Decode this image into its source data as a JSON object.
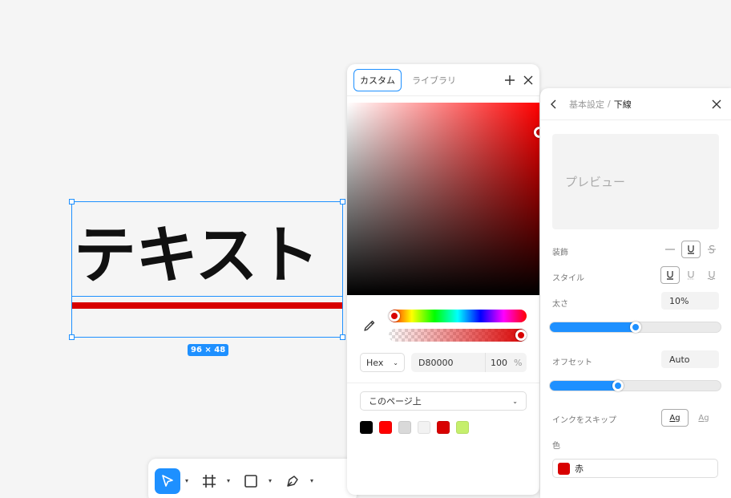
{
  "canvas": {
    "text": "テキスト",
    "size_badge": "96 × 48",
    "underline_color": "#d80000",
    "selection_color": "#1e90ff"
  },
  "toolbar": {
    "tools": [
      {
        "icon": "cursor-icon",
        "active": true
      },
      {
        "icon": "frame-icon",
        "active": false
      },
      {
        "icon": "rectangle-icon",
        "active": false
      },
      {
        "icon": "pen-icon",
        "active": false
      }
    ]
  },
  "color_picker": {
    "tabs": [
      {
        "label": "カスタム",
        "active": true
      },
      {
        "label": "ライブラリ",
        "active": false
      }
    ],
    "format": "Hex",
    "hex_value": "D80000",
    "alpha_value": "100",
    "alpha_unit": "%",
    "scope_select": "このページ上",
    "swatches": [
      "#000000",
      "#ff0000",
      "#d9d9d9",
      "#f2f2f2",
      "#d80000",
      "#c5ef6c"
    ],
    "hue_fraction": 0.0,
    "alpha_fraction": 1.0
  },
  "underline_panel": {
    "breadcrumb_parent": "基本設定",
    "breadcrumb_separator": "/",
    "breadcrumb_current": "下線",
    "preview_text": "プレビュー",
    "decoration_label": "装飾",
    "style_label": "スタイル",
    "thickness_label": "太さ",
    "thickness_value": "10%",
    "thickness_fraction": 0.5,
    "offset_label": "オフセット",
    "offset_value": "Auto",
    "offset_fraction": 0.4,
    "skip_ink_label": "インクをスキップ",
    "skip_ink_on": "Ag",
    "skip_ink_off": "Ag",
    "color_label": "色",
    "color_name": "赤",
    "color_hex": "#d80000"
  }
}
